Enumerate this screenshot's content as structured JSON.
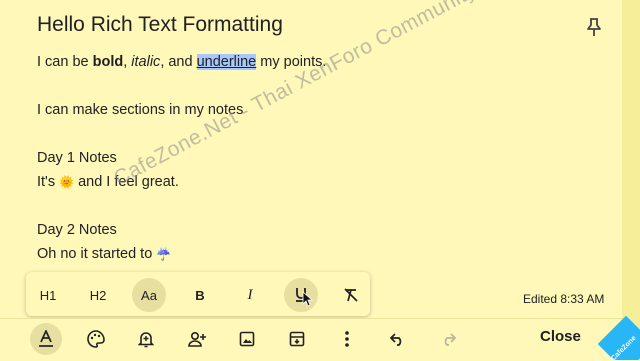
{
  "note": {
    "title": "Hello Rich Text Formatting",
    "line1": {
      "pre": "I can be ",
      "bold": "bold",
      "comma1": ", ",
      "italic": "italic",
      "mid": ", and ",
      "underline": "underline",
      "post": " my points."
    },
    "line2": "I can make sections in my notes",
    "line3": "Day 1 Notes",
    "line4": {
      "pre": "It's ",
      "emoji": "🌞",
      "post": " and I feel great."
    },
    "line5": "Day 2 Notes",
    "line6": {
      "pre": "Oh no it started to ",
      "emoji": "☔"
    }
  },
  "watermark": "CafeZone.Net - Thai XenForo Community",
  "format_toolbar": {
    "h1": "H1",
    "h2": "H2",
    "normal": "Aa",
    "bold": "B",
    "italic": "I"
  },
  "edited": "Edited 8:33 AM",
  "bottom_toolbar": {
    "close": "Close"
  },
  "badge_text": "CafeZone",
  "colors": {
    "note_bg": "#fff8b8",
    "selection": "#a8c7fa",
    "active_bg": "#e7dfa0"
  }
}
